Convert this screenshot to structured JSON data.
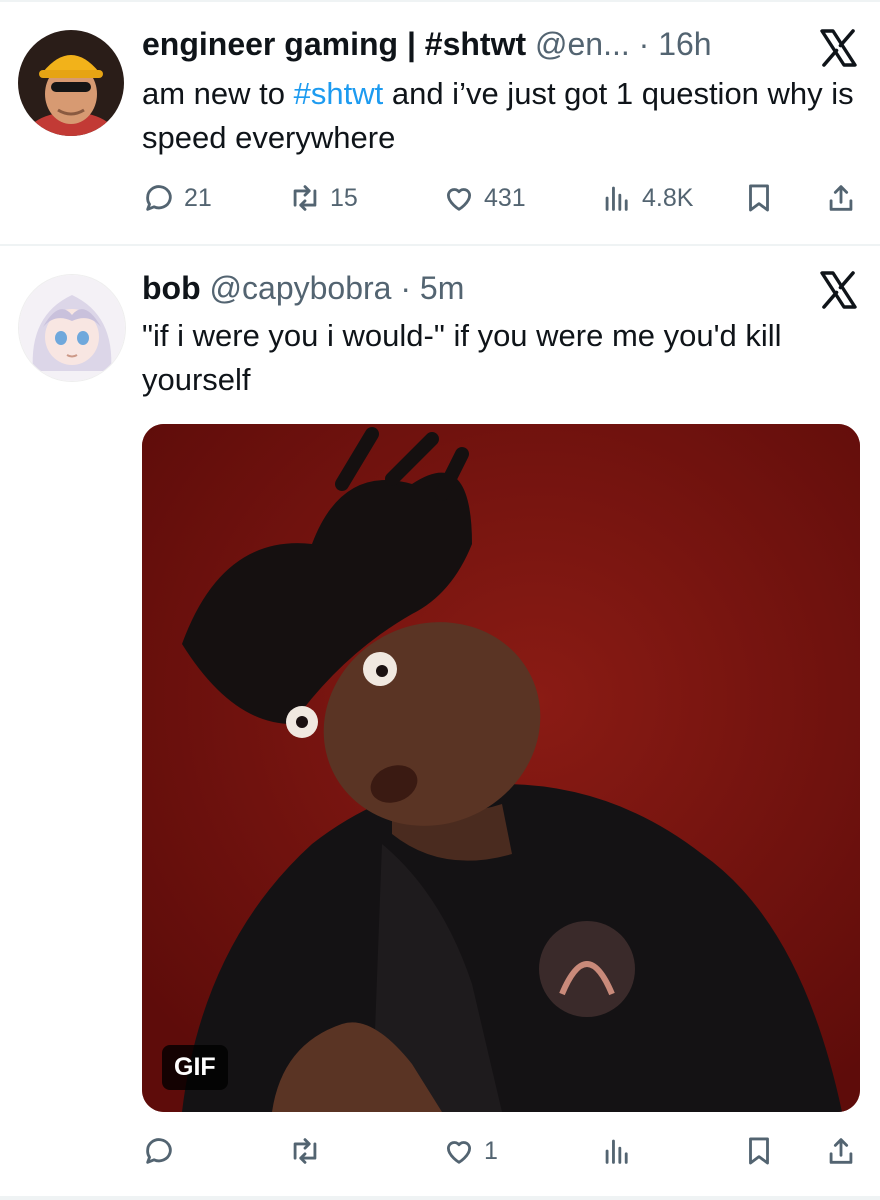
{
  "tweets": [
    {
      "name": "engineer gaming | #shtwt",
      "handle_time": "@en... · 16h",
      "text_pre": "am new to ",
      "hashtag": "#shtwt",
      "text_post": " and i’ve just got 1 question why is speed everywhere",
      "replies": "21",
      "retweets": "15",
      "likes": "431",
      "views": "4.8K",
      "avatar_icon": "hardhat-engineer-avatar"
    },
    {
      "name": "bob",
      "handle_time": "@capybobra · 5m",
      "text": "\"if i were you i would-\" if you were me you'd kill yourself",
      "likes": "1",
      "media_badge": "GIF",
      "avatar_icon": "anime-girl-avatar"
    }
  ],
  "colors": {
    "text": "#0f1419",
    "secondary": "#536471",
    "accent": "#1d9bf0",
    "media_bg": "#6d0f0c"
  },
  "icons": [
    "reply-icon",
    "retweet-icon",
    "like-icon",
    "views-icon",
    "bookmark-icon",
    "share-icon",
    "x-logo-icon"
  ]
}
